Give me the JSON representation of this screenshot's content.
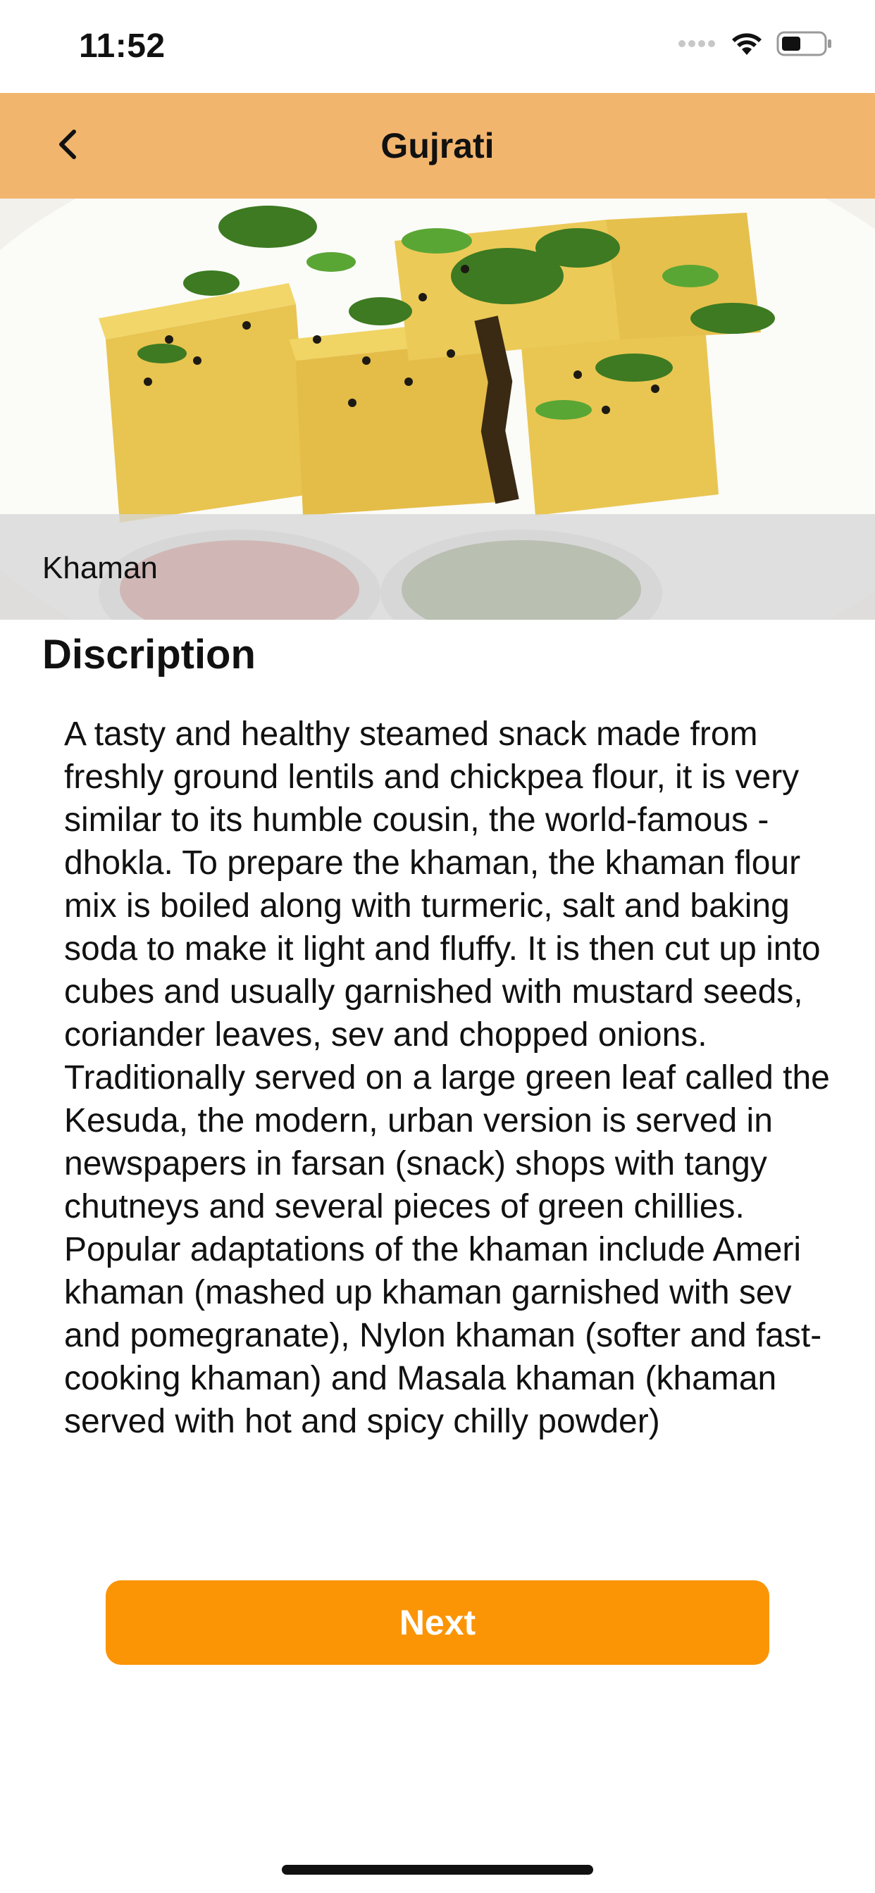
{
  "status_bar": {
    "time": "11:52",
    "icons": [
      "signal-dots-icon",
      "wifi-icon",
      "battery-icon"
    ]
  },
  "nav": {
    "title": "Gujrati",
    "back_icon": "chevron-left-icon",
    "background_color": "#f2b56e"
  },
  "hero": {
    "caption": "Khaman"
  },
  "section": {
    "heading": "Discription"
  },
  "description": "A tasty and healthy steamed snack made from freshly ground lentils and chickpea flour, it is very similar to its humble cousin, the world-famous -dhokla. To prepare the khaman, the khaman flour mix is boiled along with turmeric, salt and baking soda to make it light and fluffy. It is then cut up into cubes and usually garnished with mustard seeds, coriander leaves, sev and chopped onions. Traditionally served on a large green leaf called the Kesuda, the modern, urban version is served in newspapers in farsan (snack) shops with tangy chutneys and several pieces of green chillies. Popular adaptations of the khaman include Ameri khaman (mashed up khaman garnished with sev and pomegranate), Nylon khaman (softer and fast-cooking khaman) and Masala khaman (khaman served with hot and spicy chilly powder)",
  "actions": {
    "next_label": "Next",
    "button_color": "#fb9506"
  }
}
